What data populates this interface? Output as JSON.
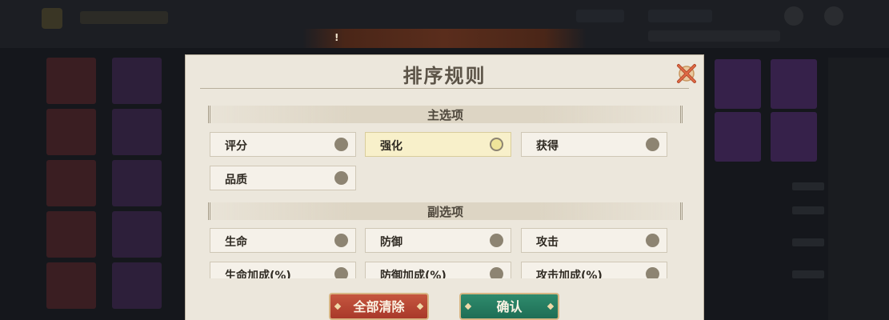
{
  "notice": {
    "text": "!"
  },
  "dialog": {
    "title": "排序规则",
    "close_icon": "close-x-icon",
    "primary": {
      "header": "主选项",
      "options": [
        {
          "label": "评分",
          "selected": false
        },
        {
          "label": "强化",
          "selected": true
        },
        {
          "label": "获得",
          "selected": false
        },
        {
          "label": "品质",
          "selected": false
        }
      ]
    },
    "secondary": {
      "header": "副选项",
      "options": [
        {
          "label": "生命",
          "selected": false
        },
        {
          "label": "防御",
          "selected": false
        },
        {
          "label": "攻击",
          "selected": false
        },
        {
          "label": "生命加成(%)",
          "selected": false
        },
        {
          "label": "防御加成(%)",
          "selected": false
        },
        {
          "label": "攻击加成(%)",
          "selected": false
        }
      ]
    },
    "buttons": {
      "clear_all": "全部清除",
      "confirm": "确认"
    }
  },
  "colors": {
    "selected_option_bg": "#f8f0ca",
    "clear_button": "#b8452f",
    "confirm_button": "#268067"
  }
}
